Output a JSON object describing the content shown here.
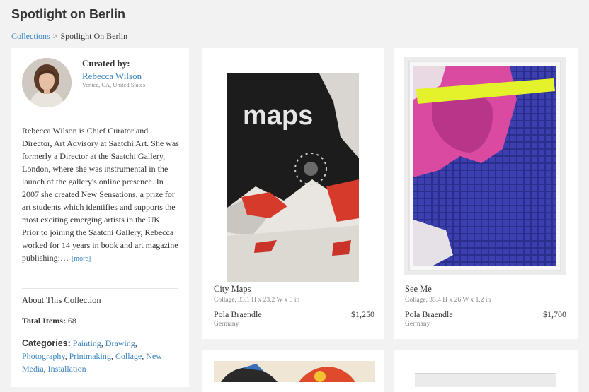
{
  "page": {
    "title": "Spotlight on Berlin"
  },
  "breadcrumb": {
    "link": "Collections",
    "separator": ">",
    "current": "Spotlight On Berlin"
  },
  "curator": {
    "label": "Curated by:",
    "name": "Rebecca Wilson",
    "location": "Venice, CA, United States",
    "bio": "Rebecca Wilson is Chief Curator and Director, Art Advisory at Saatchi Art. She was formerly a Director at the Saatchi Gallery, London, where she was instrumental in the launch of the gallery's online presence. In 2007 she created New Sensations, a prize for art students which identifies and supports the most exciting emerging artists in the UK. Prior to joining the Saatchi Gallery, Rebecca worked for 14 years in book and art magazine publishing:…",
    "more": "[more]"
  },
  "collection": {
    "about": "About This Collection",
    "total_label": "Total Items:",
    "total_value": "68",
    "categories_label": "Categories:",
    "categories": [
      "Painting",
      "Drawing",
      "Photography",
      "Printmaking",
      "Collage",
      "New Media",
      "Installation"
    ]
  },
  "artworks": [
    {
      "title": "City Maps",
      "meta": "Collage, 33.1 H x 23.2 W x 0 in",
      "artist": "Pola Braendle",
      "country": "Germany",
      "price": "$1,250",
      "art_text": "maps"
    },
    {
      "title": "See Me",
      "meta": "Collage, 35.4 H x 26 W x 1.2 in",
      "artist": "Pola Braendle",
      "country": "Germany",
      "price": "$1,700"
    }
  ]
}
